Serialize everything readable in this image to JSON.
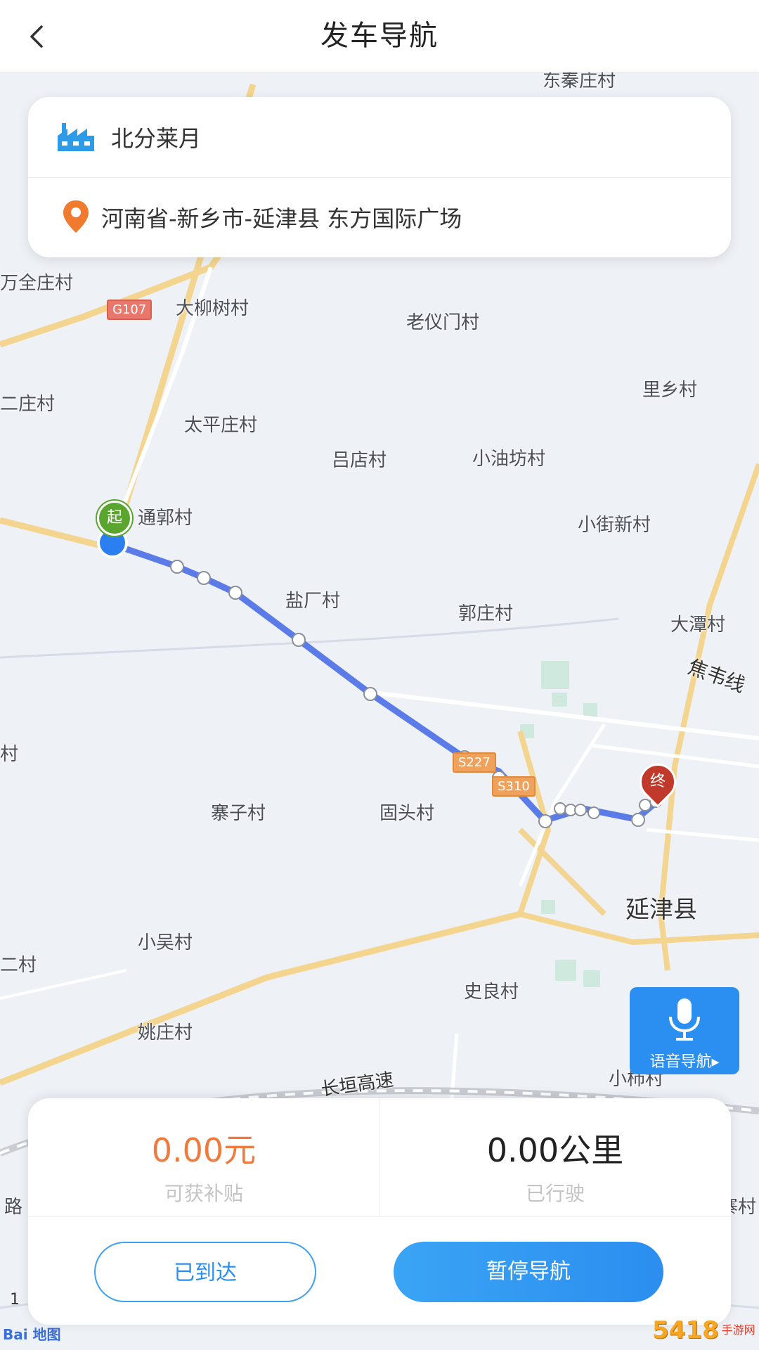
{
  "header": {
    "title": "发车导航",
    "back_icon": "chevron-left-icon"
  },
  "route": {
    "origin": "北分莱月",
    "origin_icon": "factory-icon",
    "destination": "河南省-新乡市-延津县 东方国际广场",
    "destination_icon": "location-pin-icon"
  },
  "map": {
    "places": [
      "东秦庄村",
      "万全庄村",
      "大柳树村",
      "老仪门村",
      "里乡村",
      "二庄村",
      "太平庄村",
      "吕店村",
      "小油坊村",
      "通郭村",
      "小街新村",
      "盐厂村",
      "郭庄村",
      "大潭村",
      "焦韦线",
      "寨子村",
      "固头村",
      "延津县",
      "小吴村",
      "二村",
      "史良村",
      "姚庄村",
      "小柿村",
      "路",
      "寨村",
      "村",
      "长垣高速"
    ],
    "shields": [
      "G107",
      "S227",
      "S310"
    ],
    "start_marker": "起",
    "end_marker": "终",
    "route_color": "#5b7be8",
    "location_color": "#2b7ff0"
  },
  "voice_nav": {
    "label": "语音导航▸",
    "icon": "microphone-icon"
  },
  "stats": {
    "subsidy_value": "0.00元",
    "subsidy_label": "可获补贴",
    "distance_value": "0.00公里",
    "distance_label": "已行驶"
  },
  "actions": {
    "arrived_label": "已到达",
    "pause_label": "暂停导航"
  },
  "footer": {
    "map_logo": "Bai 地图",
    "scale": "1"
  },
  "watermark": {
    "number": "5418",
    "text": "手游网"
  },
  "colors": {
    "accent": "#2a8ff0",
    "subsidy": "#ef7a3c",
    "start_green": "#5aa52e",
    "end_red": "#c0392b"
  }
}
